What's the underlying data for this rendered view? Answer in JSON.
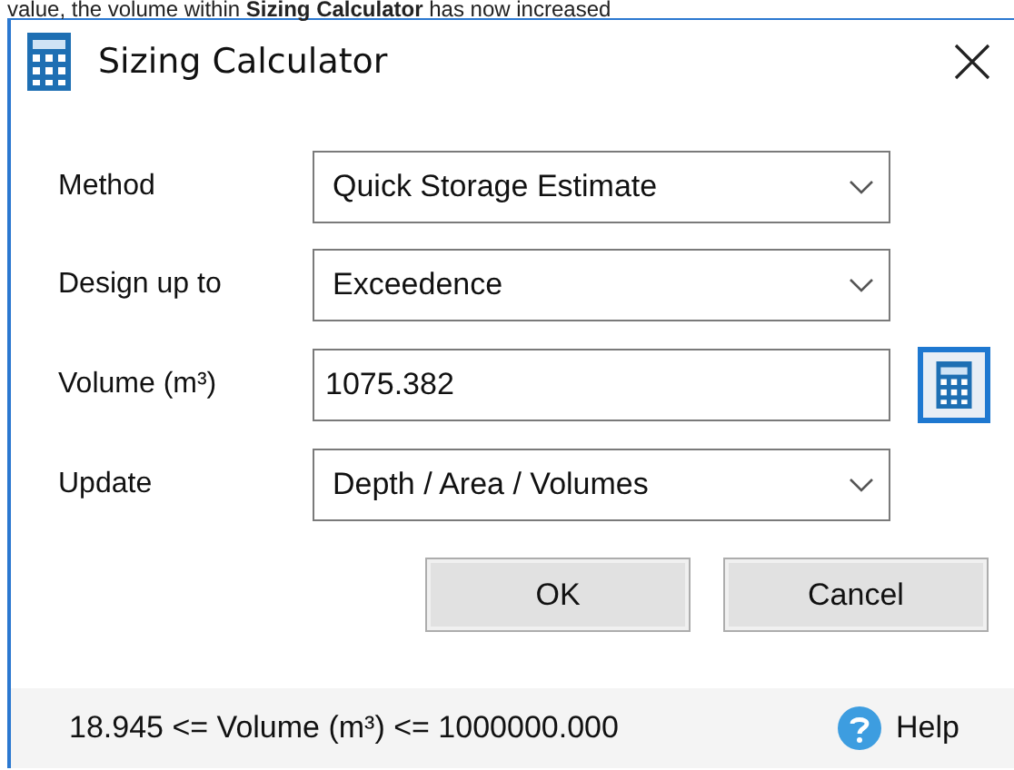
{
  "context_text": "value, the volume within **Sizing Calculator** has now increased",
  "window": {
    "title": "Sizing Calculator"
  },
  "fields": [
    {
      "kind": "combo",
      "label": "Method",
      "value": "Quick Storage Estimate"
    },
    {
      "kind": "combo",
      "label": "Design up to",
      "value": "Exceedence"
    },
    {
      "kind": "text",
      "label": "Volume (m³)",
      "value": "1075.382"
    },
    {
      "kind": "combo",
      "label": "Update",
      "value": "Depth / Area / Volumes"
    }
  ],
  "buttons": [
    "OK",
    "Cancel"
  ],
  "footer": {
    "range": "18.945 <= Volume (m³) <= 1000000.000",
    "help": "Help"
  }
}
